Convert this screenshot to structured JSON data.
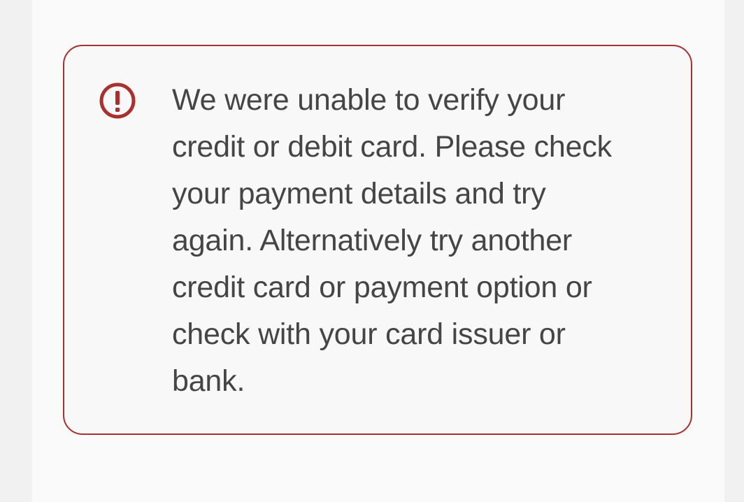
{
  "alert": {
    "icon": "error-exclamation-icon",
    "accent_color": "#a8302f",
    "text_color": "#454545",
    "message_lines": [
      "We were unable to verify your",
      "credit or debit card. Please check",
      "your payment details and try",
      "again. Alternatively try another",
      "credit card or payment option or",
      "check with your card issuer or",
      "bank."
    ]
  }
}
